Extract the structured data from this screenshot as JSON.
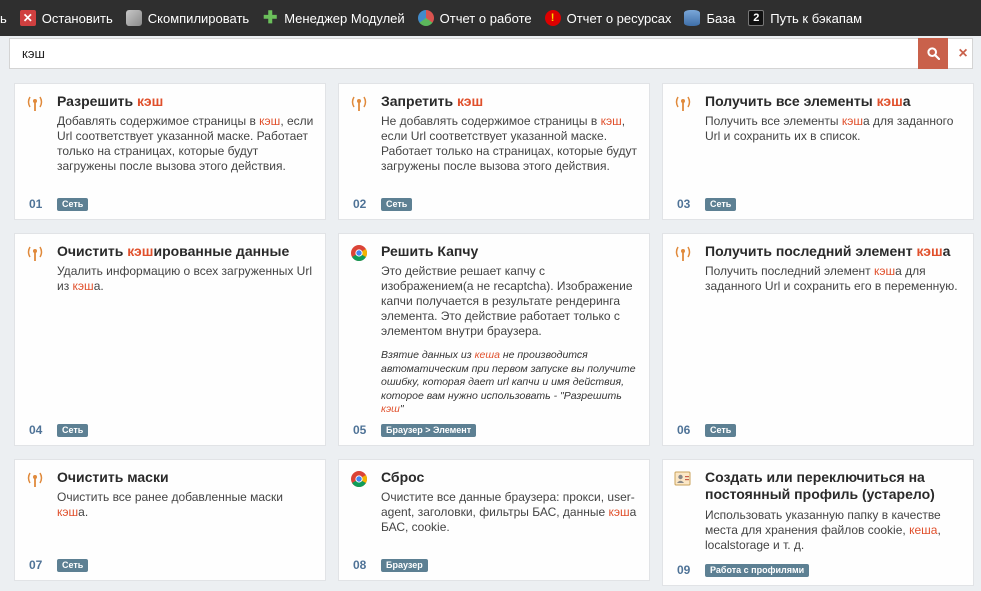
{
  "toolbar": {
    "items": [
      {
        "label": "ь",
        "icon": "partial-icon"
      },
      {
        "label": "Остановить",
        "icon": "stop-icon"
      },
      {
        "label": "Скомпилировать",
        "icon": "compile-icon"
      },
      {
        "label": "Менеджер Модулей",
        "icon": "puzzle-icon"
      },
      {
        "label": "Отчет о работе",
        "icon": "pie-chart-icon"
      },
      {
        "label": "Отчет о ресурсах",
        "icon": "warning-icon"
      },
      {
        "label": "База",
        "icon": "database-icon"
      },
      {
        "label": "Путь к бэкапам",
        "icon": "backup-icon"
      }
    ]
  },
  "search": {
    "value": "кэш",
    "accent": "#c9614b"
  },
  "highlight_color": "#e0502c",
  "cards": [
    {
      "num": "01",
      "tag": "Сеть",
      "title": [
        "Разрешить ",
        "кэш",
        ""
      ],
      "desc": [
        [
          "Добавлять содержимое страницы в ",
          "кэш",
          ", если Url соответствует указанной маске. Работает только на страницах, которые будут загружены после вызова этого действия."
        ]
      ]
    },
    {
      "num": "02",
      "tag": "Сеть",
      "title": [
        "Запретить ",
        "кэш",
        ""
      ],
      "desc": [
        [
          "Не добавлять содержимое страницы в ",
          "кэш",
          ", если Url соответствует указанной маске. Работает только на страницах, которые будут загружены после вызова этого действия."
        ]
      ]
    },
    {
      "num": "03",
      "tag": "Сеть",
      "title": [
        "Получить все элементы ",
        "кэш",
        "а"
      ],
      "desc": [
        [
          "Получить все элементы ",
          "кэш",
          "а для заданного Url и сохранить их в список."
        ]
      ]
    },
    {
      "num": "04",
      "tag": "Сеть",
      "title": [
        "Очистить ",
        "кэш",
        "ированные данные"
      ],
      "desc": [
        [
          "Удалить информацию о всех загруженных Url из ",
          "кэш",
          "а."
        ]
      ]
    },
    {
      "num": "05",
      "tag": "Браузер > Элемент",
      "title": [
        "Решить Капчу",
        "",
        ""
      ],
      "desc": [
        [
          "Это действие решает капчу с изображением(а не recaptcha). Изображение капчи получается в результате рендеринга элемента. Это действие работает только с элементом внутри браузера.",
          "",
          ""
        ]
      ],
      "note": [
        "Взятие данных из ",
        "кеша",
        " не производится автоматическим при первом запуске вы получите ошибку, которая дает url капчи и имя действия, которое вам нужно использовать - \"Разрешить ",
        "кэш",
        "\""
      ]
    },
    {
      "num": "06",
      "tag": "Сеть",
      "title": [
        "Получить последний элемент ",
        "кэш",
        "а"
      ],
      "desc": [
        [
          "Получить последний элемент ",
          "кэш",
          "а для заданного Url и сохранить его в переменную."
        ]
      ]
    },
    {
      "num": "07",
      "tag": "Сеть",
      "title": [
        "Очистить маски",
        "",
        ""
      ],
      "desc": [
        [
          "Очистить все ранее добавленные маски ",
          "кэш",
          "а."
        ]
      ]
    },
    {
      "num": "08",
      "tag": "Браузер",
      "title": [
        "Сброс",
        "",
        ""
      ],
      "desc": [
        [
          "Очистите все данные браузера: прокси, user-agent, заголовки, фильтры БАС, данные ",
          "кэш",
          "а БАС, cookie."
        ]
      ]
    },
    {
      "num": "09",
      "tag": "Работа с профилями",
      "title": [
        "Создать или переключиться на постоянный профиль (устарело)",
        "",
        ""
      ],
      "desc": [
        [
          "Использовать указанную папку в качестве места для хранения файлов cookie, ",
          "кеша",
          ", localstorage и т. д."
        ]
      ]
    }
  ]
}
